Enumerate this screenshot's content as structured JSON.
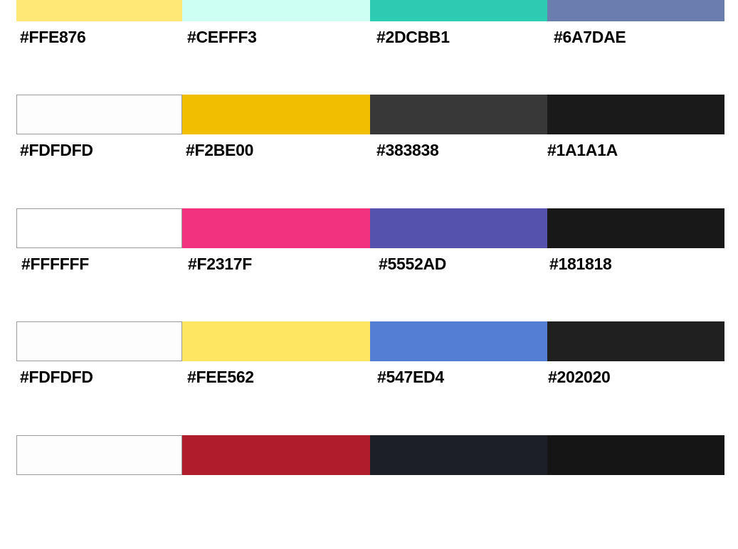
{
  "palettes": [
    {
      "swatches": [
        {
          "color": "#FFE876",
          "label": "#FFE876",
          "outlined": false
        },
        {
          "color": "#CEFFF3",
          "label": "#CEFFF3",
          "outlined": false
        },
        {
          "color": "#2DCBB1",
          "label": "#2DCBB1",
          "outlined": false
        },
        {
          "color": "#6A7DAE",
          "label": "#6A7DAE",
          "outlined": false
        }
      ]
    },
    {
      "swatches": [
        {
          "color": "#FDFDFD",
          "label": "#FDFDFD",
          "outlined": true
        },
        {
          "color": "#F2BE00",
          "label": "#F2BE00",
          "outlined": false
        },
        {
          "color": "#383838",
          "label": "#383838",
          "outlined": false
        },
        {
          "color": "#1A1A1A",
          "label": "#1A1A1A",
          "outlined": false
        }
      ]
    },
    {
      "swatches": [
        {
          "color": "#FFFFFF",
          "label": "#FFFFFF",
          "outlined": true
        },
        {
          "color": "#F2317F",
          "label": "#F2317F",
          "outlined": false
        },
        {
          "color": "#5552AD",
          "label": "#5552AD",
          "outlined": false
        },
        {
          "color": "#181818",
          "label": "#181818",
          "outlined": false
        }
      ]
    },
    {
      "swatches": [
        {
          "color": "#FDFDFD",
          "label": "#FDFDFD",
          "outlined": true
        },
        {
          "color": "#FEE562",
          "label": "#FEE562",
          "outlined": false
        },
        {
          "color": "#547ED4",
          "label": "#547ED4",
          "outlined": false
        },
        {
          "color": "#202020",
          "label": "#202020",
          "outlined": false
        }
      ]
    },
    {
      "swatches": [
        {
          "color": "#FDFDFD",
          "label": "",
          "outlined": true
        },
        {
          "color": "#B01C2B",
          "label": "",
          "outlined": false
        },
        {
          "color": "#1C1F28",
          "label": "",
          "outlined": false
        },
        {
          "color": "#151515",
          "label": "",
          "outlined": false
        }
      ]
    }
  ]
}
